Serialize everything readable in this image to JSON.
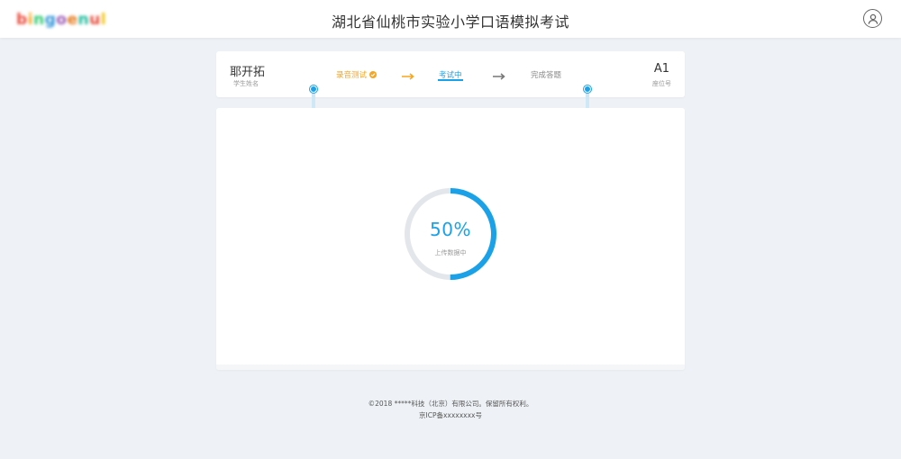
{
  "header": {
    "logo_text": "bingoenul",
    "title": "湖北省仙桃市实验小学口语模拟考试"
  },
  "student": {
    "name": "耶开拓",
    "name_label": "学生姓名",
    "seat_no": "A1",
    "seat_label": "座位号"
  },
  "steps": [
    {
      "label": "录音测试",
      "status": "done"
    },
    {
      "label": "考试中",
      "status": "active"
    },
    {
      "label": "完成答题",
      "status": "pending"
    }
  ],
  "progress": {
    "percent_text": "50%",
    "value": 0.5,
    "label": "上传数据中"
  },
  "footer": {
    "copyright": "©2018 *****科技（北京）有限公司。保留所有权利。",
    "icp": "京ICP备xxxxxxxx号"
  },
  "colors": {
    "accent_blue": "#1aa1e8",
    "step_done_orange": "#f5a623",
    "ring_track": "#e3e6ea",
    "background": "#eef2f6"
  },
  "icons": {
    "user": "user-circle-icon",
    "check": "check-circle-icon",
    "arrow": "arrow-right-icon"
  }
}
